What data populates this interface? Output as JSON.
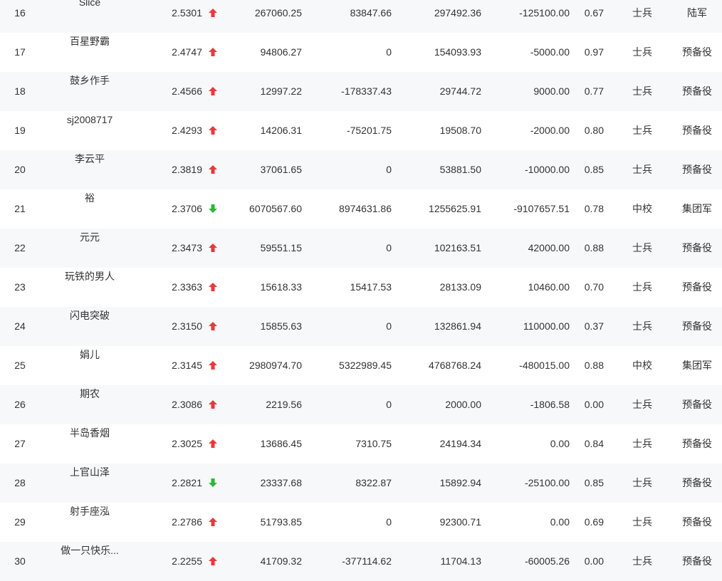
{
  "colors": {
    "up": "#e8393a",
    "down": "#2cb736",
    "row_alt": "#f7f8fa"
  },
  "rows": [
    {
      "rank": "16",
      "name": "Slice",
      "score": "2.5301",
      "trend": "up",
      "total": "267060.25",
      "v2": "83847.66",
      "v3": "297492.36",
      "v4": "-125100.00",
      "ratio": "0.67",
      "rank_name": "士兵",
      "corps": "陆军"
    },
    {
      "rank": "17",
      "name": "百星野霸",
      "score": "2.4747",
      "trend": "up",
      "total": "94806.27",
      "v2": "0",
      "v3": "154093.93",
      "v4": "-5000.00",
      "ratio": "0.97",
      "rank_name": "士兵",
      "corps": "预备役"
    },
    {
      "rank": "18",
      "name": "鼓乡作手",
      "score": "2.4566",
      "trend": "up",
      "total": "12997.22",
      "v2": "-178337.43",
      "v3": "29744.72",
      "v4": "9000.00",
      "ratio": "0.77",
      "rank_name": "士兵",
      "corps": "预备役"
    },
    {
      "rank": "19",
      "name": "sj2008717",
      "score": "2.4293",
      "trend": "up",
      "total": "14206.31",
      "v2": "-75201.75",
      "v3": "19508.70",
      "v4": "-2000.00",
      "ratio": "0.80",
      "rank_name": "士兵",
      "corps": "预备役"
    },
    {
      "rank": "20",
      "name": "李云平",
      "score": "2.3819",
      "trend": "up",
      "total": "37061.65",
      "v2": "0",
      "v3": "53881.50",
      "v4": "-10000.00",
      "ratio": "0.85",
      "rank_name": "士兵",
      "corps": "预备役"
    },
    {
      "rank": "21",
      "name": "裕",
      "score": "2.3706",
      "trend": "down",
      "total": "6070567.60",
      "v2": "8974631.86",
      "v3": "1255625.91",
      "v4": "-9107657.51",
      "ratio": "0.78",
      "rank_name": "中校",
      "corps": "集团军"
    },
    {
      "rank": "22",
      "name": "元元",
      "score": "2.3473",
      "trend": "up",
      "total": "59551.15",
      "v2": "0",
      "v3": "102163.51",
      "v4": "42000.00",
      "ratio": "0.88",
      "rank_name": "士兵",
      "corps": "预备役"
    },
    {
      "rank": "23",
      "name": "玩铁的男人",
      "score": "2.3363",
      "trend": "up",
      "total": "15618.33",
      "v2": "15417.53",
      "v3": "28133.09",
      "v4": "10460.00",
      "ratio": "0.70",
      "rank_name": "士兵",
      "corps": "预备役"
    },
    {
      "rank": "24",
      "name": "闪电突破",
      "score": "2.3150",
      "trend": "up",
      "total": "15855.63",
      "v2": "0",
      "v3": "132861.94",
      "v4": "110000.00",
      "ratio": "0.37",
      "rank_name": "士兵",
      "corps": "预备役"
    },
    {
      "rank": "25",
      "name": "娟儿",
      "score": "2.3145",
      "trend": "up",
      "total": "2980974.70",
      "v2": "5322989.45",
      "v3": "4768768.24",
      "v4": "-480015.00",
      "ratio": "0.88",
      "rank_name": "中校",
      "corps": "集团军"
    },
    {
      "rank": "26",
      "name": "期农",
      "score": "2.3086",
      "trend": "up",
      "total": "2219.56",
      "v2": "0",
      "v3": "2000.00",
      "v4": "-1806.58",
      "ratio": "0.00",
      "rank_name": "士兵",
      "corps": "预备役"
    },
    {
      "rank": "27",
      "name": "半岛香烟",
      "score": "2.3025",
      "trend": "up",
      "total": "13686.45",
      "v2": "7310.75",
      "v3": "24194.34",
      "v4": "0.00",
      "ratio": "0.84",
      "rank_name": "士兵",
      "corps": "预备役"
    },
    {
      "rank": "28",
      "name": "上官山泽",
      "score": "2.2821",
      "trend": "down",
      "total": "23337.68",
      "v2": "8322.87",
      "v3": "15892.94",
      "v4": "-25100.00",
      "ratio": "0.85",
      "rank_name": "士兵",
      "corps": "预备役"
    },
    {
      "rank": "29",
      "name": "射手座泓",
      "score": "2.2786",
      "trend": "up",
      "total": "51793.85",
      "v2": "0",
      "v3": "92300.71",
      "v4": "0.00",
      "ratio": "0.69",
      "rank_name": "士兵",
      "corps": "预备役"
    },
    {
      "rank": "30",
      "name": "做一只快乐...",
      "score": "2.2255",
      "trend": "up",
      "total": "41709.32",
      "v2": "-377114.62",
      "v3": "11704.13",
      "v4": "-60005.26",
      "ratio": "0.00",
      "rank_name": "士兵",
      "corps": "预备役"
    }
  ]
}
